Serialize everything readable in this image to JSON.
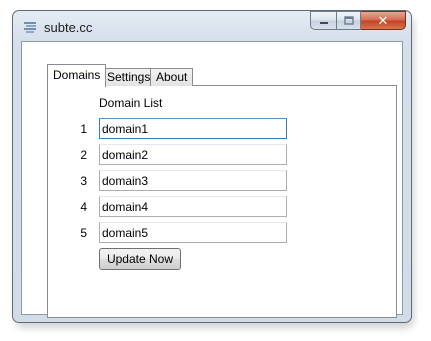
{
  "window": {
    "title": "subte.cc",
    "min_icon": "minimize-icon",
    "max_icon": "maximize-icon",
    "close_label": "✕"
  },
  "tabs": [
    {
      "label": "Domains",
      "active": true
    },
    {
      "label": "Settings",
      "active": false
    },
    {
      "label": "About",
      "active": false
    }
  ],
  "domains": {
    "list_label": "Domain List",
    "items": [
      {
        "num": "1",
        "value": "domain1"
      },
      {
        "num": "2",
        "value": "domain2"
      },
      {
        "num": "3",
        "value": "domain3"
      },
      {
        "num": "4",
        "value": "domain4"
      },
      {
        "num": "5",
        "value": "domain5"
      }
    ],
    "update_button": "Update Now"
  }
}
